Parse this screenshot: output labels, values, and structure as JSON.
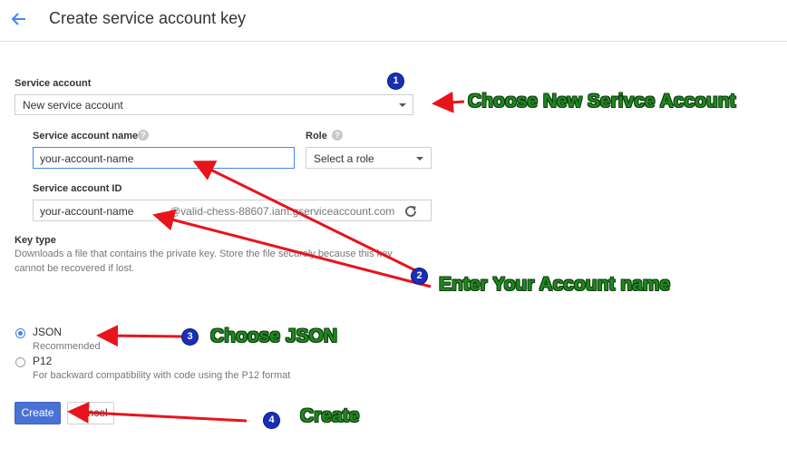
{
  "header": {
    "title": "Create service account key"
  },
  "form": {
    "service_account_label": "Service account",
    "service_account_value": "New service account",
    "account_name_label": "Service account name",
    "account_name_value": "your-account-name",
    "role_label": "Role",
    "role_value": "Select a role",
    "account_id_label": "Service account ID",
    "account_id_value": "your-account-name",
    "account_id_suffix": "@valid-chess-88607.iam.gserviceaccount.com",
    "key_type_label": "Key type",
    "key_type_desc_line1": "Downloads a file that contains the private key. Store the file securely because this key",
    "key_type_desc_line2": "cannot be recovered if lost.",
    "options": [
      {
        "label": "JSON",
        "desc": "Recommended",
        "selected": true
      },
      {
        "label": "P12",
        "desc": "For backward compatibility with code using the P12 format",
        "selected": false
      }
    ],
    "create_label": "Create",
    "cancel_label": "Cancel"
  },
  "annotations": {
    "badges": [
      "1",
      "2",
      "3",
      "4"
    ],
    "callout1": "Choose New Serivce Account",
    "callout2": "Enter Your Account name",
    "callout3": "Choose JSON",
    "callout4": "Create",
    "arrow_color": "#e8141c",
    "badge_color": "#1a2fb5",
    "callout_color": "#1f8a1f"
  },
  "colors": {
    "accent": "#4285f4",
    "primary_button": "#4a72d4"
  },
  "icons": {
    "back": "arrow-left-icon",
    "help": "help-circle-icon",
    "refresh": "refresh-icon",
    "dropdown": "caret-down-icon"
  }
}
